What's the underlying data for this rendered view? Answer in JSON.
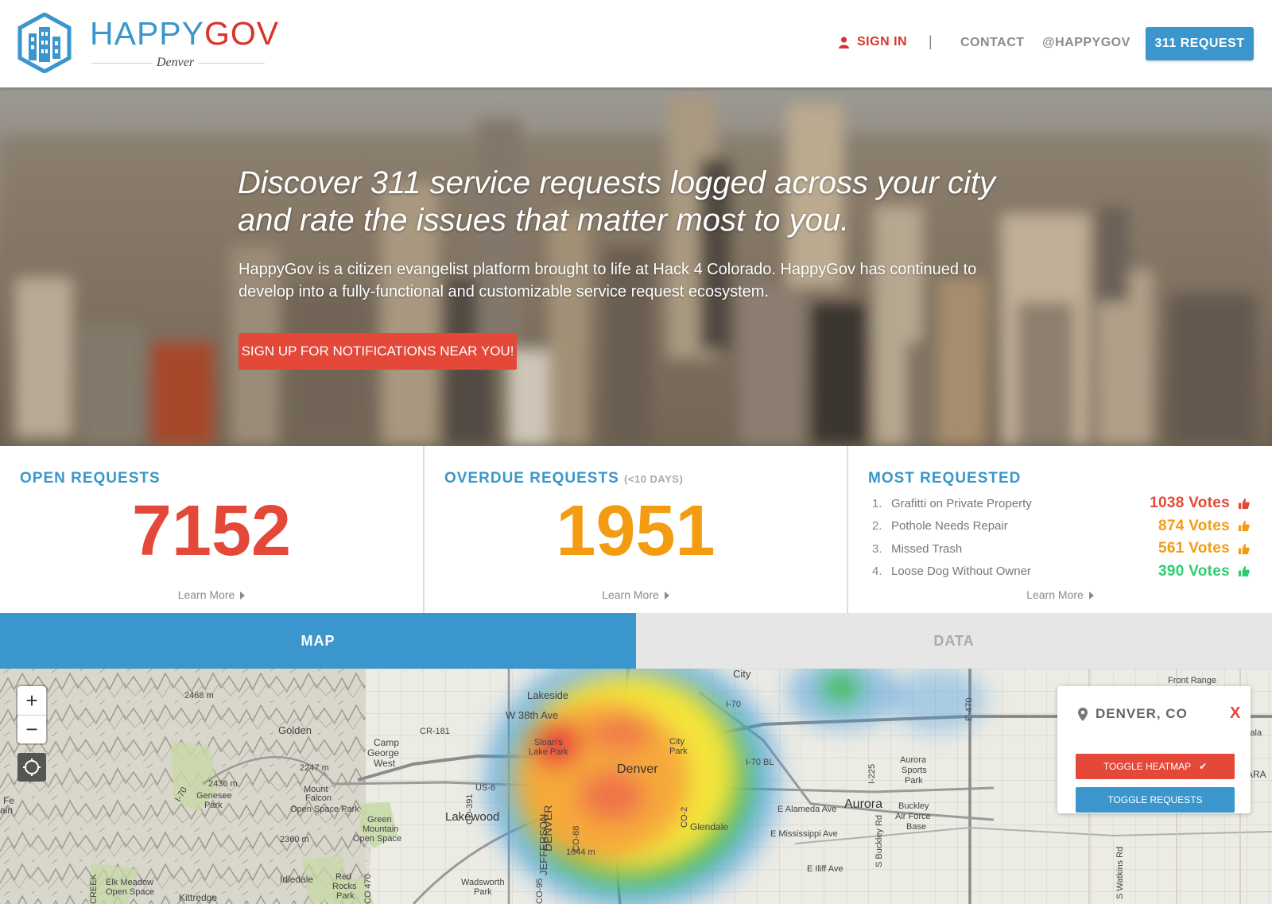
{
  "brand": {
    "name_part1": "HAPPY",
    "name_part2": "GOV",
    "city": "Denver",
    "primary_color": "#3a96cc",
    "accent_color": "#d9342b"
  },
  "nav": {
    "sign_in": "SIGN IN",
    "separator": "|",
    "contact": "CONTACT",
    "twitter": "@HAPPYGOV",
    "request_button": "311 REQUEST"
  },
  "hero": {
    "title_line1": "Discover 311 service requests logged across your city",
    "title_line2": "and rate the issues that matter most to you.",
    "description": "HappyGov is a citizen evangelist platform brought to life at Hack 4 Colorado. HappyGov has continued to develop into a fully-functional and customizable service request ecosystem.",
    "cta": "SIGN UP FOR NOTIFICATIONS NEAR YOU!"
  },
  "stats": {
    "open": {
      "title": "OPEN REQUESTS",
      "value": "7152",
      "learn_more": "Learn More",
      "color": "#e34838"
    },
    "overdue": {
      "title": "OVERDUE REQUESTS",
      "subtitle": "(<10 DAYS)",
      "value": "1951",
      "learn_more": "Learn More",
      "color": "#f39c12"
    },
    "most_requested": {
      "title": "MOST REQUESTED",
      "learn_more": "Learn More",
      "items": [
        {
          "num": "1.",
          "name": "Grafitti on Private Property",
          "votes": "1038 Votes",
          "color": "#e34838"
        },
        {
          "num": "2.",
          "name": "Pothole Needs Repair",
          "votes": "874 Votes",
          "color": "#f39c12"
        },
        {
          "num": "3.",
          "name": "Missed Trash",
          "votes": "561 Votes",
          "color": "#f39c12"
        },
        {
          "num": "4.",
          "name": "Loose Dog Without Owner",
          "votes": "390 Votes",
          "color": "#2ecc71"
        }
      ]
    }
  },
  "tabs": {
    "map": "MAP",
    "data": "DATA"
  },
  "map": {
    "zoom_in": "+",
    "zoom_out": "−",
    "panel": {
      "location": "DENVER, CO",
      "close": "X",
      "toggle_heatmap": "TOGGLE HEATMAP",
      "heatmap_check": "✔",
      "toggle_requests": "TOGGLE REQUESTS"
    }
  }
}
